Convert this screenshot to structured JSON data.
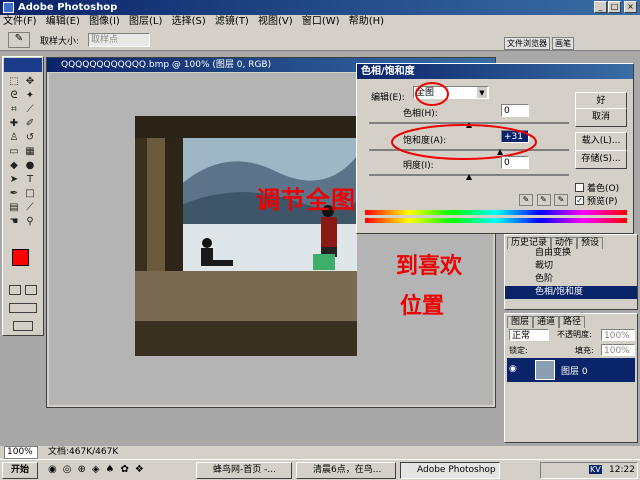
{
  "app": {
    "title": "Adobe Photoshop"
  },
  "menu": [
    "文件(F)",
    "编辑(E)",
    "图像(I)",
    "图层(L)",
    "选择(S)",
    "滤镜(T)",
    "视图(V)",
    "窗口(W)",
    "帮助(H)"
  ],
  "options": {
    "sample_label": "取样大小:",
    "sample_value": "取样点",
    "tab_file_browser": "文件浏览器",
    "tab_brushes": "画笔"
  },
  "document": {
    "title": "QQQQQQQQQQQQ.bmp @ 100% (图层 0, RGB)"
  },
  "dialog": {
    "title": "色相/饱和度",
    "edit_label": "编辑(E):",
    "edit_value": "全图",
    "hue_label": "色相(H):",
    "hue_value": "0",
    "sat_label": "饱和度(A):",
    "sat_value": "+31",
    "light_label": "明度(I):",
    "light_value": "0",
    "ok": "好",
    "cancel": "取消",
    "load": "载入(L)...",
    "save": "存储(S)...",
    "colorize": "着色(O)",
    "preview": "预览(P)",
    "preview_checked": true,
    "hue_level": 0,
    "sat_level": 31,
    "light_level": 0
  },
  "annotation": {
    "line1": "调节全图饱和度",
    "line2": "到喜欢",
    "line3": "位置"
  },
  "history": {
    "tabs": [
      "历史记录",
      "动作",
      "预设"
    ],
    "items": [
      "自由变换",
      "裁切",
      "色阶",
      "色相/饱和度"
    ],
    "selected_index": 3
  },
  "layers": {
    "tabs": [
      "图层",
      "通道",
      "路径"
    ],
    "blend_mode": "正常",
    "opacity_label": "不透明度:",
    "opacity_value": "100%",
    "lock_label": "锁定:",
    "fill_label": "填充:",
    "fill_value": "100%",
    "layer_name": "图层 0"
  },
  "status": {
    "zoom": "100%",
    "doc": "文档:467K/467K"
  },
  "taskbar": {
    "start": "开始",
    "tasks": [
      "蜂鸟网-首页 -...",
      "清晨6点，在鸟...",
      "Adobe Photoshop"
    ],
    "clock": "12:22",
    "lang": "KV"
  },
  "colors": {
    "foreground": "#ff0000",
    "background": "#ffffff",
    "title_blue": "#0a246a",
    "annotation_red": "#e00000"
  }
}
